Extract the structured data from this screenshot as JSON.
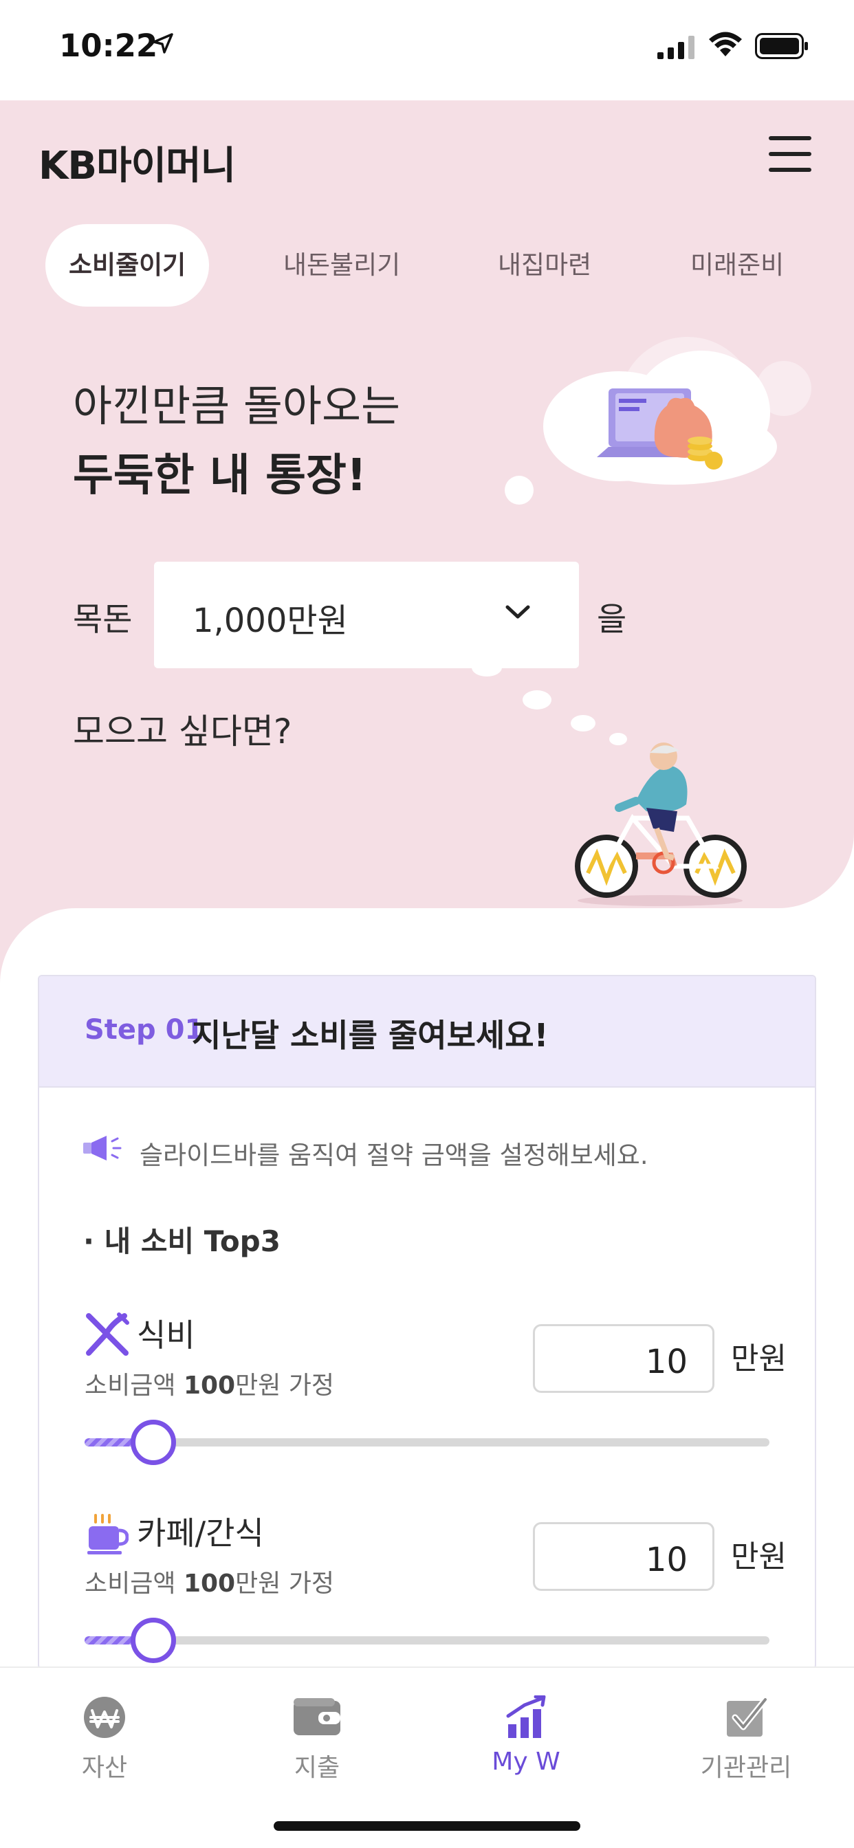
{
  "status_bar": {
    "time": "10:22"
  },
  "header": {
    "logo": "KB마이머니"
  },
  "tabs": [
    {
      "label": "소비줄이기",
      "active": true
    },
    {
      "label": "내돈불리기",
      "active": false
    },
    {
      "label": "내집마련",
      "active": false
    },
    {
      "label": "미래준비",
      "active": false
    }
  ],
  "hero": {
    "line1": "아낀만큼 돌아오는",
    "line2": "두둑한 내 통장!",
    "goal_label": "목돈",
    "goal_value": "1,000만원",
    "goal_suffix": "을",
    "goal_question": "모으고 싶다면?"
  },
  "card": {
    "step": "Step 01",
    "title": "지난달 소비를 줄여보세요!",
    "notice": "슬라이드바를 움직여 절약 금액을 설정해보세요.",
    "subtitle": "· 내 소비 Top3",
    "items": [
      {
        "name": "식비",
        "desc_prefix": "소비금액 ",
        "desc_amount": "100",
        "desc_suffix": "만원 가정",
        "value": "10",
        "unit": "만원",
        "slider_fraction": 0.1
      },
      {
        "name": "카페/간식",
        "desc_prefix": "소비금액 ",
        "desc_amount": "100",
        "desc_suffix": "만원 가정",
        "value": "10",
        "unit": "만원",
        "slider_fraction": 0.1
      }
    ]
  },
  "bottom_nav": [
    {
      "label": "자산",
      "icon": "won-coin-icon",
      "active": false
    },
    {
      "label": "지출",
      "icon": "wallet-icon",
      "active": false
    },
    {
      "label": "My W",
      "icon": "chart-up-icon",
      "active": true
    },
    {
      "label": "기관관리",
      "icon": "checkbox-icon",
      "active": false
    }
  ],
  "colors": {
    "hero_bg": "#f5dfe5",
    "accent": "#7a52e6",
    "card_head_bg": "#eeeafb"
  }
}
